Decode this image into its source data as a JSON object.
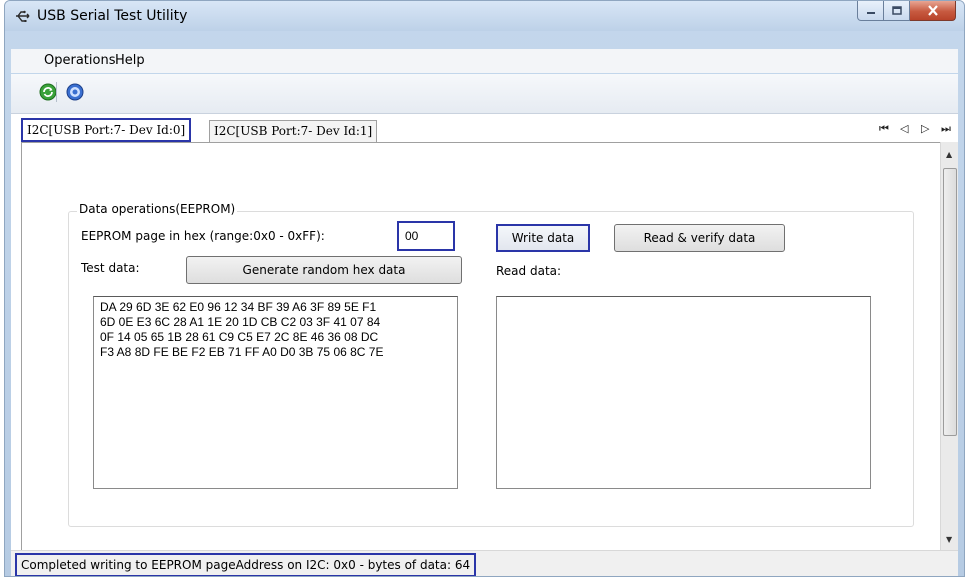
{
  "window": {
    "title": "USB Serial Test Utility"
  },
  "menu": {
    "items": [
      "Operations",
      "Help"
    ]
  },
  "toolbar": {
    "refresh_icon": "refresh-icon",
    "help_icon": "help-icon"
  },
  "tabs": [
    {
      "label": "I2C[USB Port:7- Dev Id:0]",
      "active": true
    },
    {
      "label": "I2C[USB Port:7- Dev Id:1]",
      "active": false
    }
  ],
  "tab_nav": {
    "first": "⏮",
    "prev": "◁",
    "next": "▷",
    "last": "⏭"
  },
  "group": {
    "title": "Data operations(EEPROM)",
    "page_label": "EEPROM page in hex (range:0x0 - 0xFF):",
    "page_value": "00",
    "write_button": "Write data",
    "read_button": "Read & verify data",
    "test_data_label": "Test data:",
    "generate_button": "Generate random hex data",
    "read_data_label": "Read data:",
    "test_data": "DA 29 6D 3E 62 E0 96 12 34 BF 39 A6 3F 89 5E F1\n6D 0E E3 6C 28 A1 1E 20 1D CB C2 03 3F 41 07 84\n0F 14 05 65 1B 28 61 C9 C5 E7 2C 8E 46 36 08 DC\nF3 A8 8D FE BE F2 EB 71 FF A0 D0 3B 75 06 8C 7E",
    "read_data": ""
  },
  "status": {
    "text": "Completed writing to EEPROM pageAddress on I2C: 0x0 - bytes of data: 64"
  },
  "colors": {
    "highlight": "#2a35a8",
    "close_button": "#c75a40"
  }
}
